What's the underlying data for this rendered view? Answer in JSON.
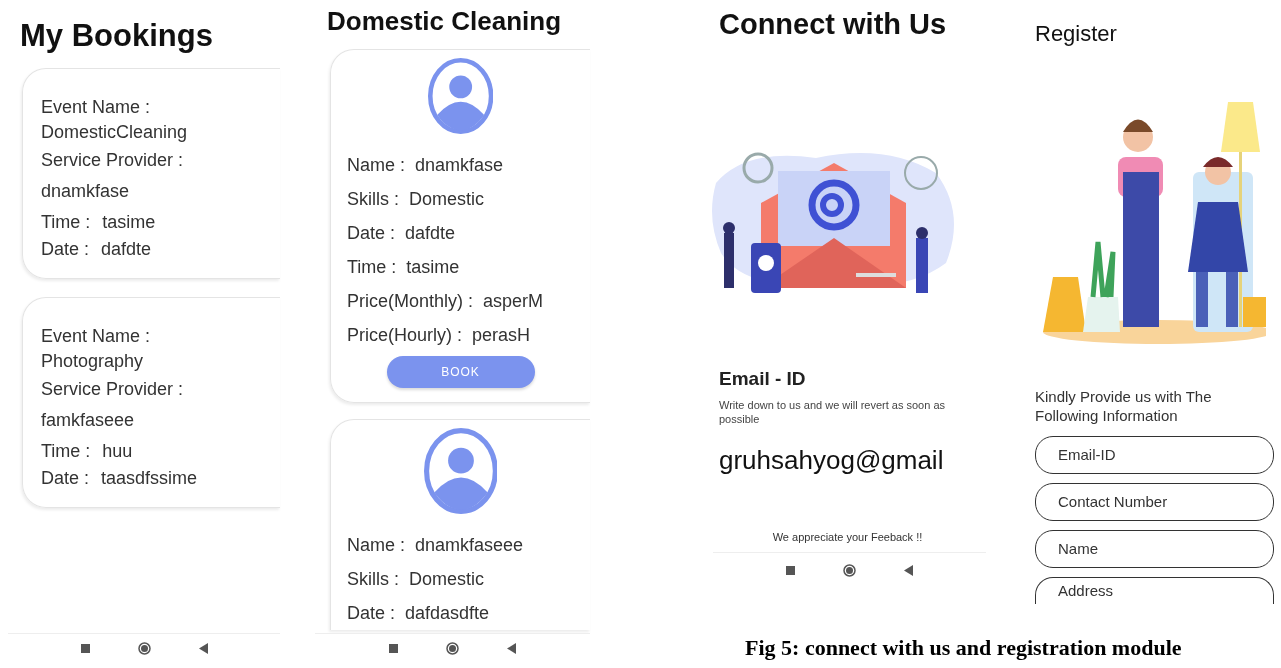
{
  "bookings_screen": {
    "title": "My Bookings",
    "bookings": [
      {
        "event_label": "Event Name :",
        "event": "DomesticCleaning",
        "provider_label": "Service Provider :",
        "provider": "dnamkfase",
        "time_label": "Time :",
        "time": "tasime",
        "date_label": "Date :",
        "date": "dafdte"
      },
      {
        "event_label": "Event Name :",
        "event": "Photography",
        "provider_label": "Service Provider :",
        "provider": "famkfaseee",
        "time_label": "Time :",
        "time": "huu",
        "date_label": "Date :",
        "date": "taasdfssime"
      }
    ]
  },
  "cleaning_screen": {
    "title": "Domestic Cleaning",
    "providers": [
      {
        "rows": [
          {
            "label": "Name :",
            "value": "dnamkfase"
          },
          {
            "label": "Skills :",
            "value": "Domestic"
          },
          {
            "label": "Date :",
            "value": "dafdte"
          },
          {
            "label": "Time :",
            "value": "tasime"
          },
          {
            "label": "Price(Monthly) :",
            "value": "asperM"
          },
          {
            "label": "Price(Hourly) :",
            "value": "perasH"
          }
        ],
        "button": "BOOK"
      },
      {
        "rows": [
          {
            "label": "Name :",
            "value": "dnamkfaseee"
          },
          {
            "label": "Skills :",
            "value": "Domestic"
          },
          {
            "label": "Date :",
            "value": "dafdasdfte"
          }
        ]
      }
    ]
  },
  "contact_screen": {
    "title": "Connect with Us",
    "heading": "Email - ID",
    "description": "Write down to us and we will revert as soon as possible",
    "email": "gruhsahyog@gmail",
    "footer": "We appreciate your Feeback !!"
  },
  "register_screen": {
    "title": "Register",
    "intro": "Kindly Provide us with The Following Information",
    "fields": [
      {
        "placeholder": "Email-ID"
      },
      {
        "placeholder": "Contact Number"
      },
      {
        "placeholder": "Name"
      },
      {
        "placeholder": "Address",
        "cut": true
      }
    ]
  },
  "caption": "Fig 5: connect with us and registration module"
}
